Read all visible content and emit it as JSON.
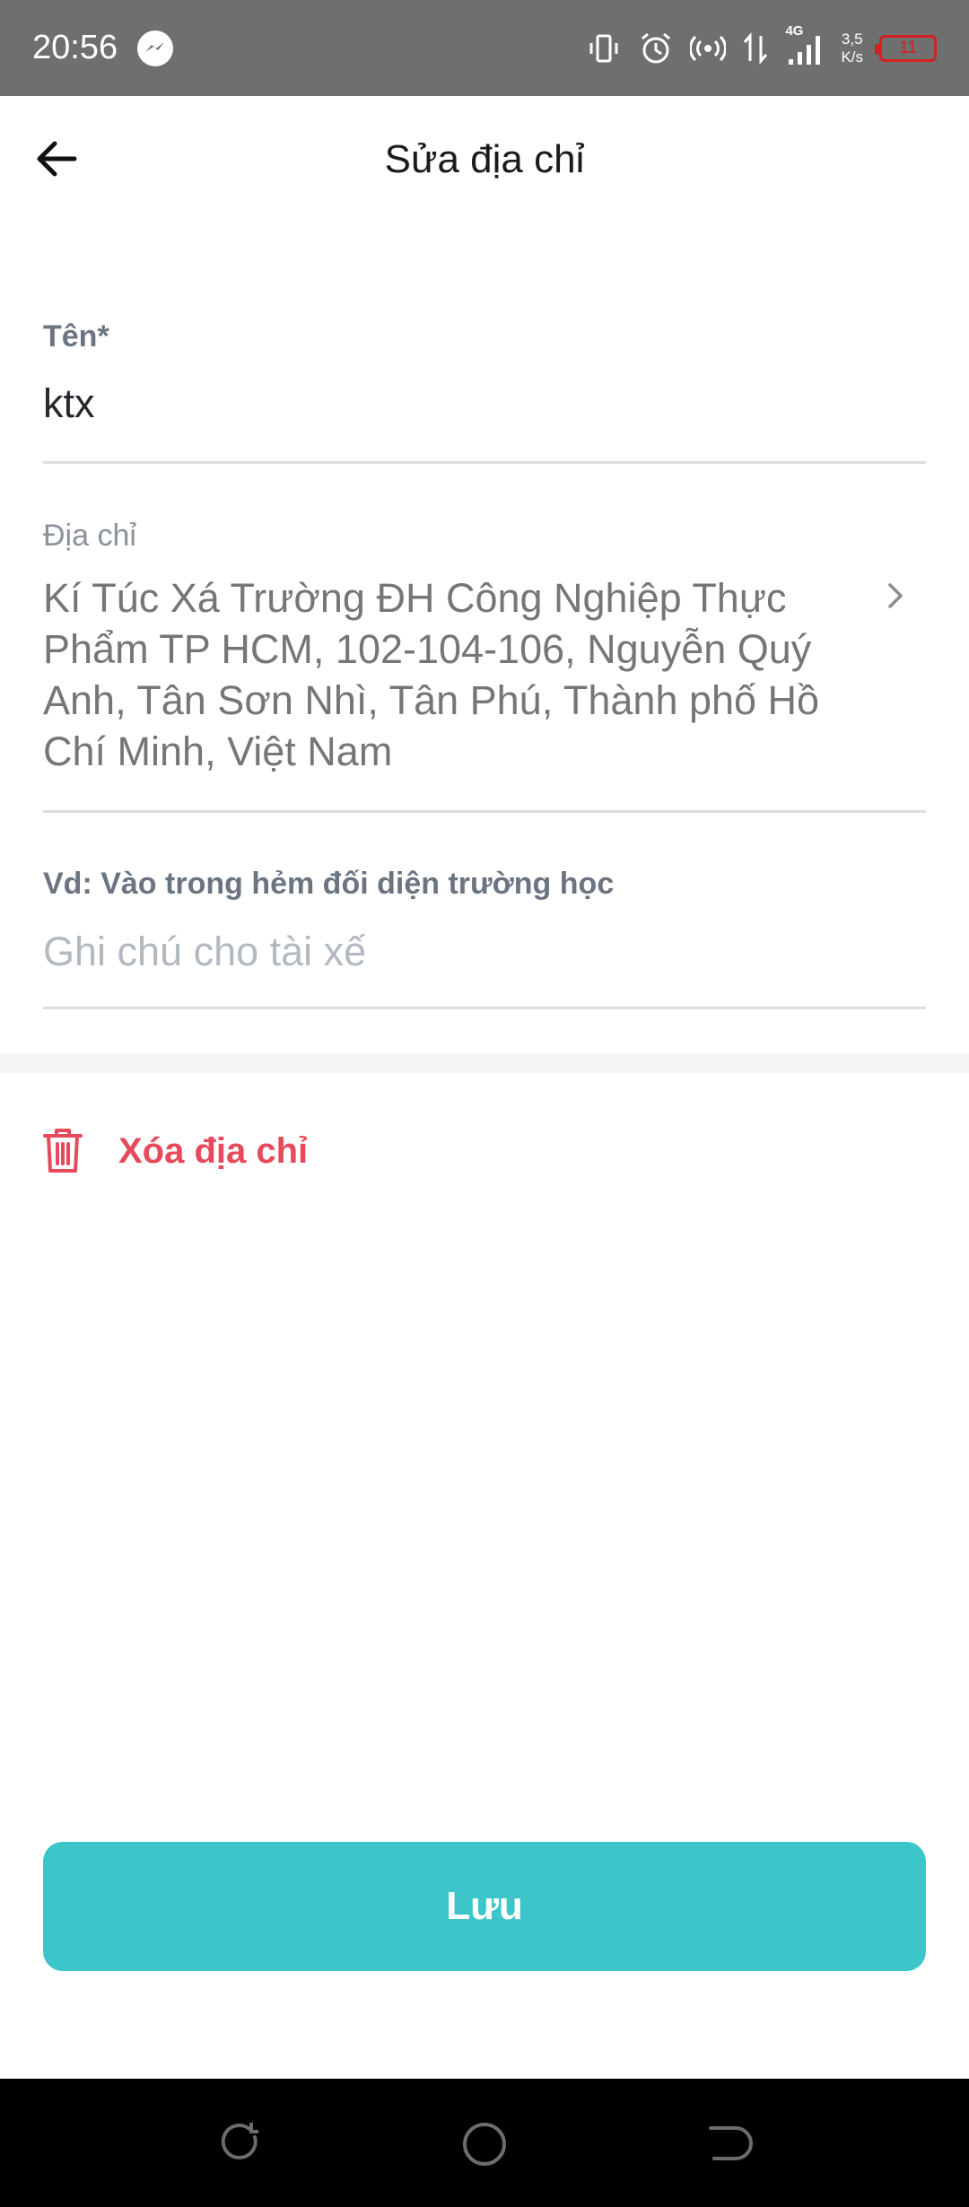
{
  "status_bar": {
    "time": "20:56",
    "network_type": "4G",
    "speed_value": "3,5",
    "speed_unit": "K/s",
    "battery_level": "11",
    "icons": [
      "messenger-icon",
      "vibrate-icon",
      "alarm-icon",
      "hotspot-icon",
      "data-transfer-icon",
      "signal-icon",
      "battery-icon"
    ]
  },
  "header": {
    "title": "Sửa địa chỉ",
    "back_icon": "arrow-left-icon"
  },
  "form": {
    "name_label": "Tên*",
    "name_value": "ktx",
    "address_label": "Địa chỉ",
    "address_value": "Kí Túc Xá Trường ĐH Công Nghiệp Thực Phẩm TP HCM, 102-104-106, Nguyễn Quý Anh, Tân Sơn Nhì, Tân Phú, Thành phố Hồ Chí Minh, Việt Nam",
    "note_label": "Vd: Vào trong hẻm đối diện trường học",
    "note_placeholder": "Ghi chú cho tài xế",
    "note_value": ""
  },
  "delete": {
    "label": "Xóa địa chỉ",
    "icon": "trash-icon"
  },
  "save_button": {
    "label": "Lưu"
  },
  "colors": {
    "accent": "#3cc6c9",
    "danger": "#e64a5c",
    "status_bar": "#6f6f6f",
    "label": "#6b7582",
    "placeholder": "#b3b9c1"
  },
  "nav_bar": {
    "buttons": [
      "recent-apps-icon",
      "home-icon",
      "back-nav-icon"
    ]
  }
}
